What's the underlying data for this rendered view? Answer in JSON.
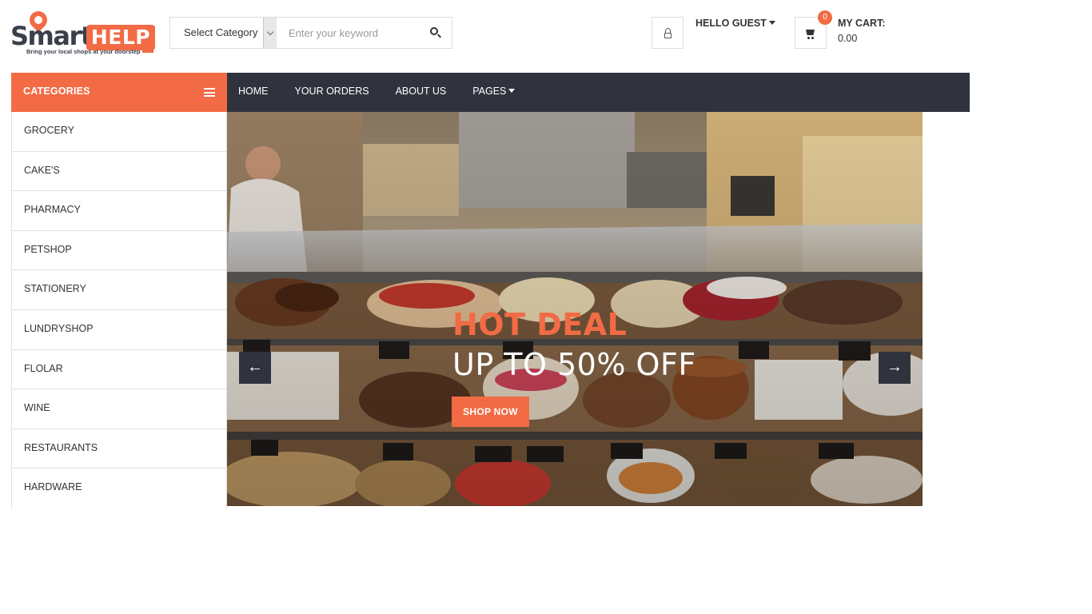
{
  "logo": {
    "brand_a": "Smart",
    "brand_b": "HELP",
    "tagline": "Bring your local shops at your doorstep"
  },
  "search": {
    "category_value": "Select Category",
    "placeholder": "Enter your keyword"
  },
  "account": {
    "greeting": "HELLO GUEST"
  },
  "cart": {
    "count": "0",
    "label": "MY CART:",
    "total": "0.00"
  },
  "nav": {
    "categories_label": "CATEGORIES",
    "links": [
      "HOME",
      "YOUR ORDERS",
      "ABOUT US",
      "PAGES"
    ]
  },
  "categories": [
    "GROCERY",
    "CAKE'S",
    "PHARMACY",
    "PETSHOP",
    "STATIONERY",
    "LUNDRYSHOP",
    "FLOLAR",
    "WINE",
    "RESTAURANTS",
    "HARDWARE"
  ],
  "hero": {
    "headline": "HOT DEAL",
    "subheadline": "UP TO 50% OFF",
    "button": "SHOP NOW",
    "prev_arrow": "←",
    "next_arrow": "→"
  },
  "colors": {
    "accent": "#f26b45",
    "nav_bg": "#30333d"
  }
}
